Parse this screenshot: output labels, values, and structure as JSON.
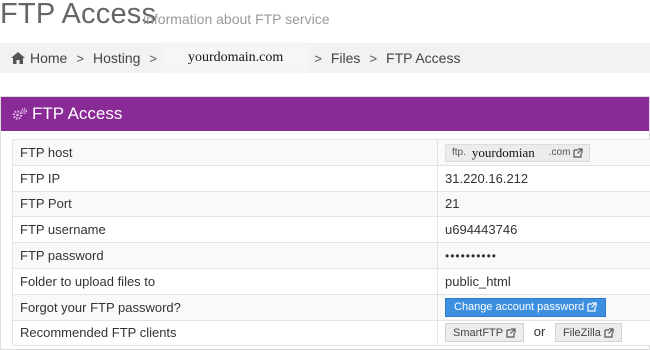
{
  "header": {
    "title": "FTP Access",
    "subtitle": "information about FTP service"
  },
  "breadcrumb": {
    "items": [
      "Home",
      "Hosting",
      "yourdomain.com",
      "Files",
      "FTP Access"
    ],
    "separator": ">"
  },
  "panel": {
    "title": "FTP Access",
    "header_color": "#8a2a97"
  },
  "rows": {
    "host": {
      "label": "FTP host",
      "prefix": "ftp.",
      "domain": "yourdomian",
      "suffix": ".com"
    },
    "ip": {
      "label": "FTP IP",
      "value": "31.220.16.212"
    },
    "port": {
      "label": "FTP Port",
      "value": "21"
    },
    "username": {
      "label": "FTP username",
      "value": "u694443746"
    },
    "password": {
      "label": "FTP password",
      "value": "••••••••••"
    },
    "folder": {
      "label": "Folder to upload files to",
      "value": "public_html"
    },
    "forgot": {
      "label": "Forgot your FTP password?",
      "button": "Change account password"
    },
    "clients": {
      "label": "Recommended FTP clients",
      "client1": "SmartFTP",
      "or": "or",
      "client2": "FileZilla"
    }
  },
  "colors": {
    "accent_blue": "#3d8fe0"
  }
}
